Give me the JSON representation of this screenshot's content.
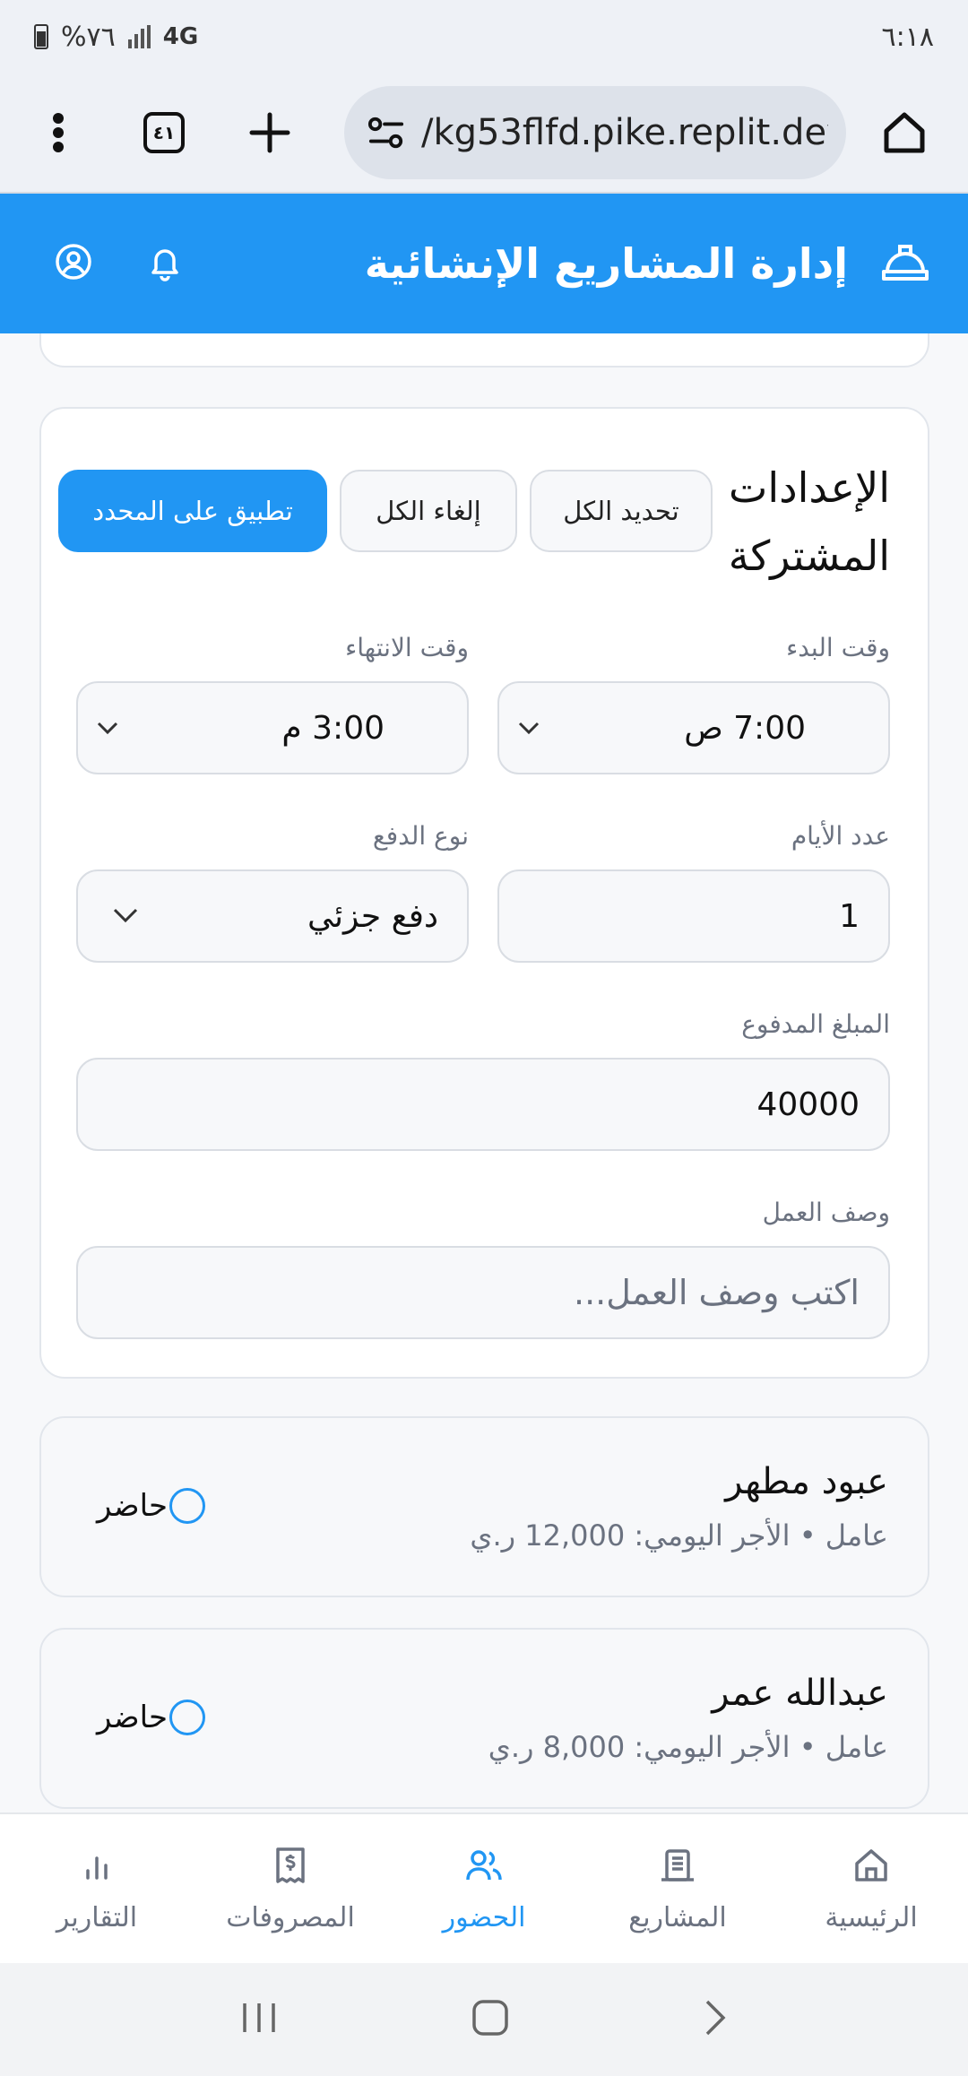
{
  "status_bar": {
    "time": "٦:١٨",
    "battery": "%٧٦",
    "network": "4G"
  },
  "browser": {
    "url": "/kg53flfd.pike.replit.dev",
    "tab_count": "٤١"
  },
  "header": {
    "title": "إدارة المشاريع الإنشائية",
    "icons": [
      "hard-hat-icon",
      "bell-icon",
      "user-circle-icon"
    ]
  },
  "settings": {
    "title": "الإعدادات المشتركة",
    "select_all": "تحديد الكل",
    "deselect_all": "إلغاء الكل",
    "apply_selected": "تطبيق على المحدد",
    "start_time_label": "وقت البدء",
    "start_time_value": "7:00 ص",
    "end_time_label": "وقت الانتهاء",
    "end_time_value": "3:00 م",
    "days_label": "عدد الأيام",
    "days_value": "1",
    "payment_type_label": "نوع الدفع",
    "payment_type_value": "دفع جزئي",
    "paid_amount_label": "المبلغ المدفوع",
    "paid_amount_value": "40000",
    "work_desc_label": "وصف العمل",
    "work_desc_placeholder": "اكتب وصف العمل..."
  },
  "workers": [
    {
      "name": "عبود مطهر",
      "details": "عامل • الأجر اليومي: 12,000 ر.ي",
      "status": "حاضر"
    },
    {
      "name": "عبدالله عمر",
      "details": "عامل • الأجر اليومي: 8,000 ر.ي",
      "status": "حاضر"
    }
  ],
  "bottom_nav": [
    {
      "label": "الرئيسية",
      "icon": "home-icon",
      "active": false
    },
    {
      "label": "المشاريع",
      "icon": "building-icon",
      "active": false
    },
    {
      "label": "الحضور",
      "icon": "users-icon",
      "active": true
    },
    {
      "label": "المصروفات",
      "icon": "receipt-icon",
      "active": false
    },
    {
      "label": "التقارير",
      "icon": "bar-chart-icon",
      "active": false
    }
  ],
  "colors": {
    "primary": "#2196f3",
    "card_border": "#e2e6ec",
    "muted_text": "#6b7280"
  }
}
